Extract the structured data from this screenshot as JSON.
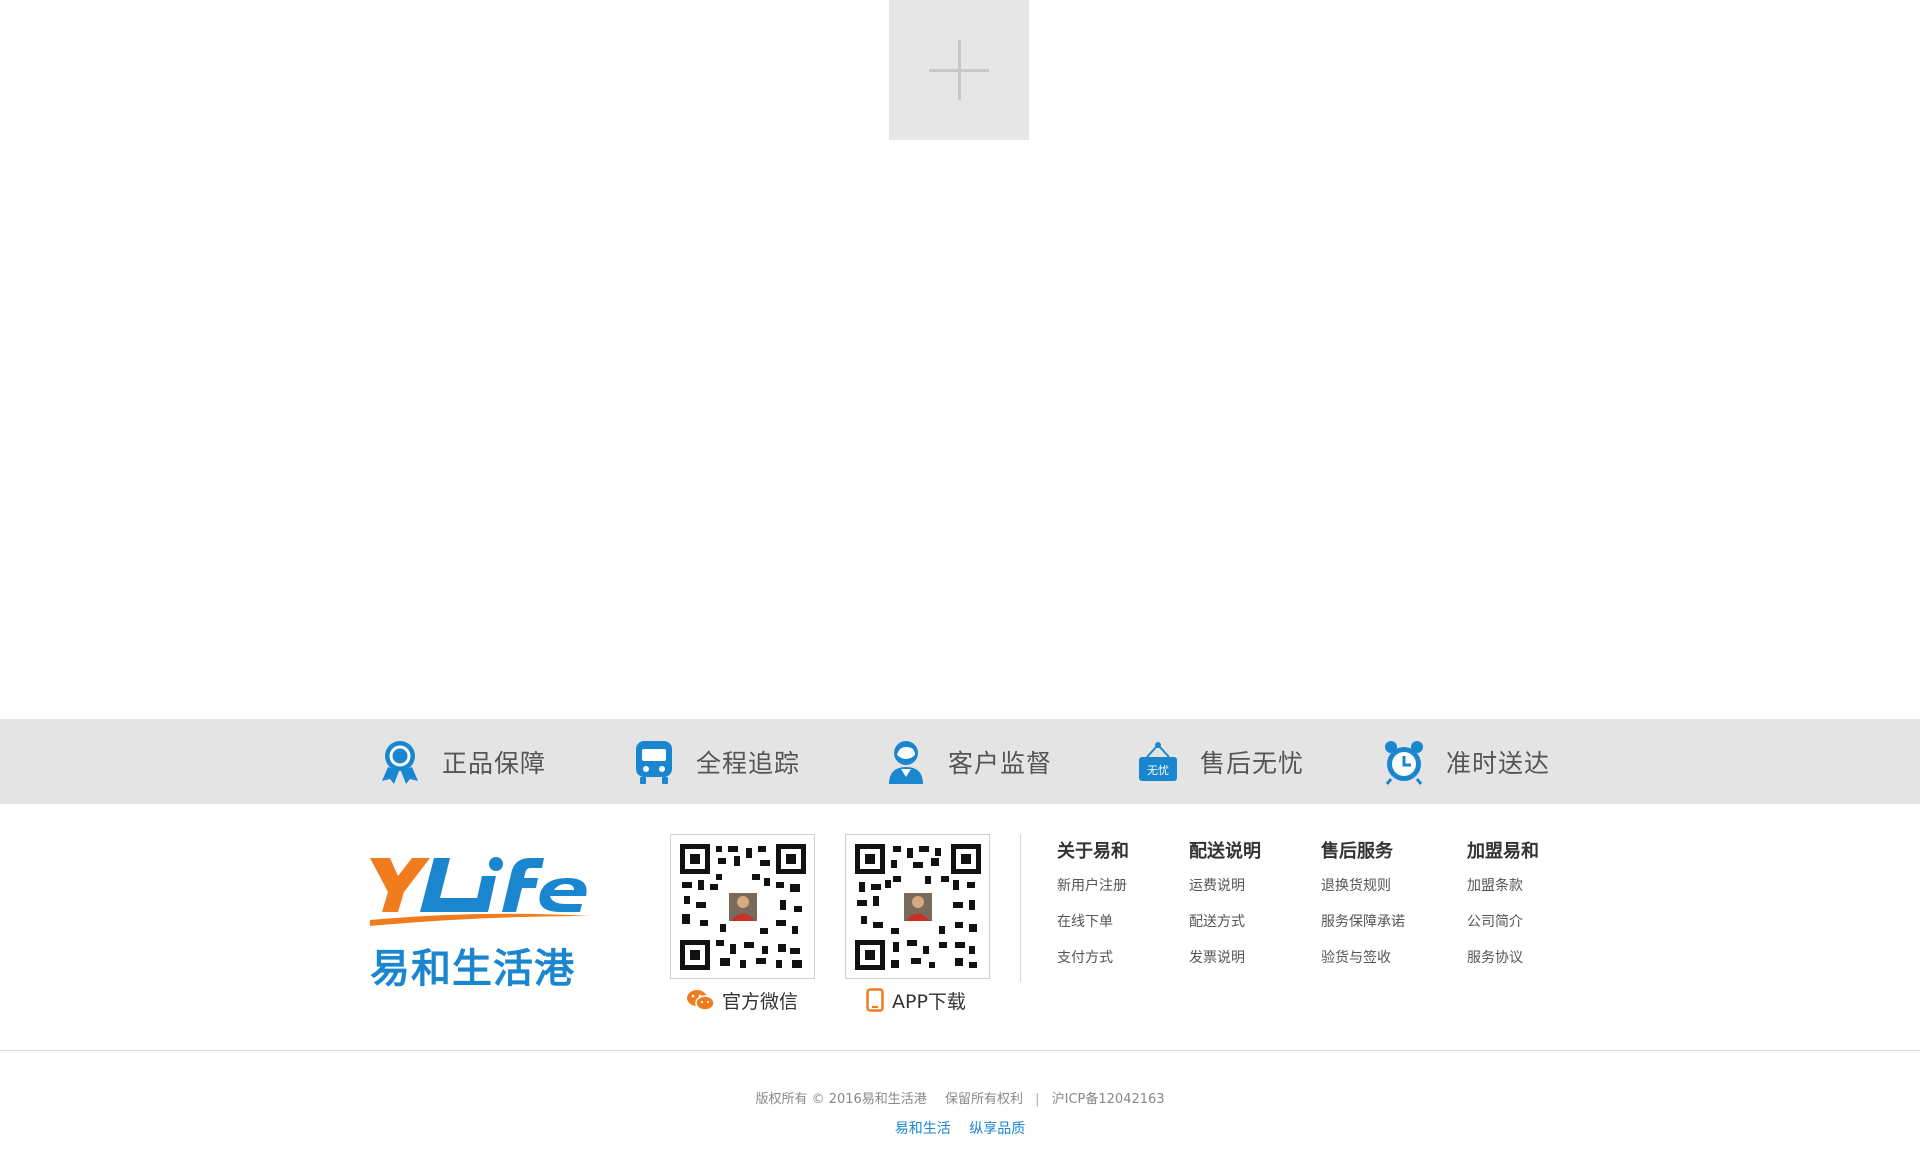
{
  "guarantees": [
    {
      "label": "正品保障",
      "icon": "award-ribbon-icon"
    },
    {
      "label": "全程追踪",
      "icon": "bus-icon"
    },
    {
      "label": "客户监督",
      "icon": "person-icon"
    },
    {
      "label": "售后无忧",
      "icon": "sign-icon",
      "badge": "无忧"
    },
    {
      "label": "准时送达",
      "icon": "alarm-clock-icon"
    }
  ],
  "logo": {
    "brand_latin": "YHLife",
    "brand_cn": "易和生活港"
  },
  "qr": [
    {
      "caption": "官方微信",
      "icon": "wechat-icon"
    },
    {
      "caption": "APP下载",
      "icon": "mobile-phone-icon"
    }
  ],
  "link_columns": [
    {
      "title": "关于易和",
      "links": [
        "新用户注册",
        "在线下单",
        "支付方式"
      ]
    },
    {
      "title": "配送说明",
      "links": [
        "运费说明",
        "配送方式",
        "发票说明"
      ]
    },
    {
      "title": "售后服务",
      "links": [
        "退换货规则",
        "服务保障承诺",
        "验货与签收"
      ]
    },
    {
      "title": "加盟易和",
      "links": [
        "加盟条款",
        "公司简介",
        "服务协议"
      ]
    }
  ],
  "copyright": {
    "text": "版权所有 © 2016易和生活港",
    "rights": "保留所有权利",
    "separator": "|",
    "icp": "沪ICP备12042163"
  },
  "slogan": {
    "part1": "易和生活",
    "part2": "纵享品质"
  },
  "colors": {
    "brand_blue": "#1a86d0",
    "brand_orange": "#f07c1e",
    "bar_gray": "#e4e4e4"
  }
}
